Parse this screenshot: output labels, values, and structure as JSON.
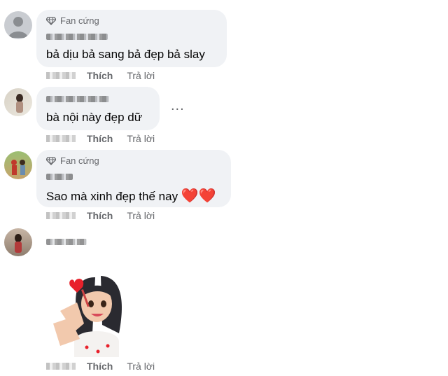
{
  "badge": {
    "fan_label": "Fan cứng",
    "icon": "diamond-icon"
  },
  "actions": {
    "like": "Thích",
    "reply": "Trả lời"
  },
  "more_label": "...",
  "comments": [
    {
      "text": "bả dịu bả sang bả đẹp bả slay",
      "has_badge": true
    },
    {
      "text": "bà nội này đẹp dữ",
      "has_badge": false
    },
    {
      "text": "Sao mà xinh đẹp thế nay",
      "emoji": "❤️❤️",
      "has_badge": true
    },
    {
      "text": "",
      "sticker": "heart-girl-sticker",
      "has_badge": false
    }
  ],
  "colors": {
    "bubble": "#f0f2f5",
    "meta": "#65676b",
    "heart": "#e8212b"
  }
}
